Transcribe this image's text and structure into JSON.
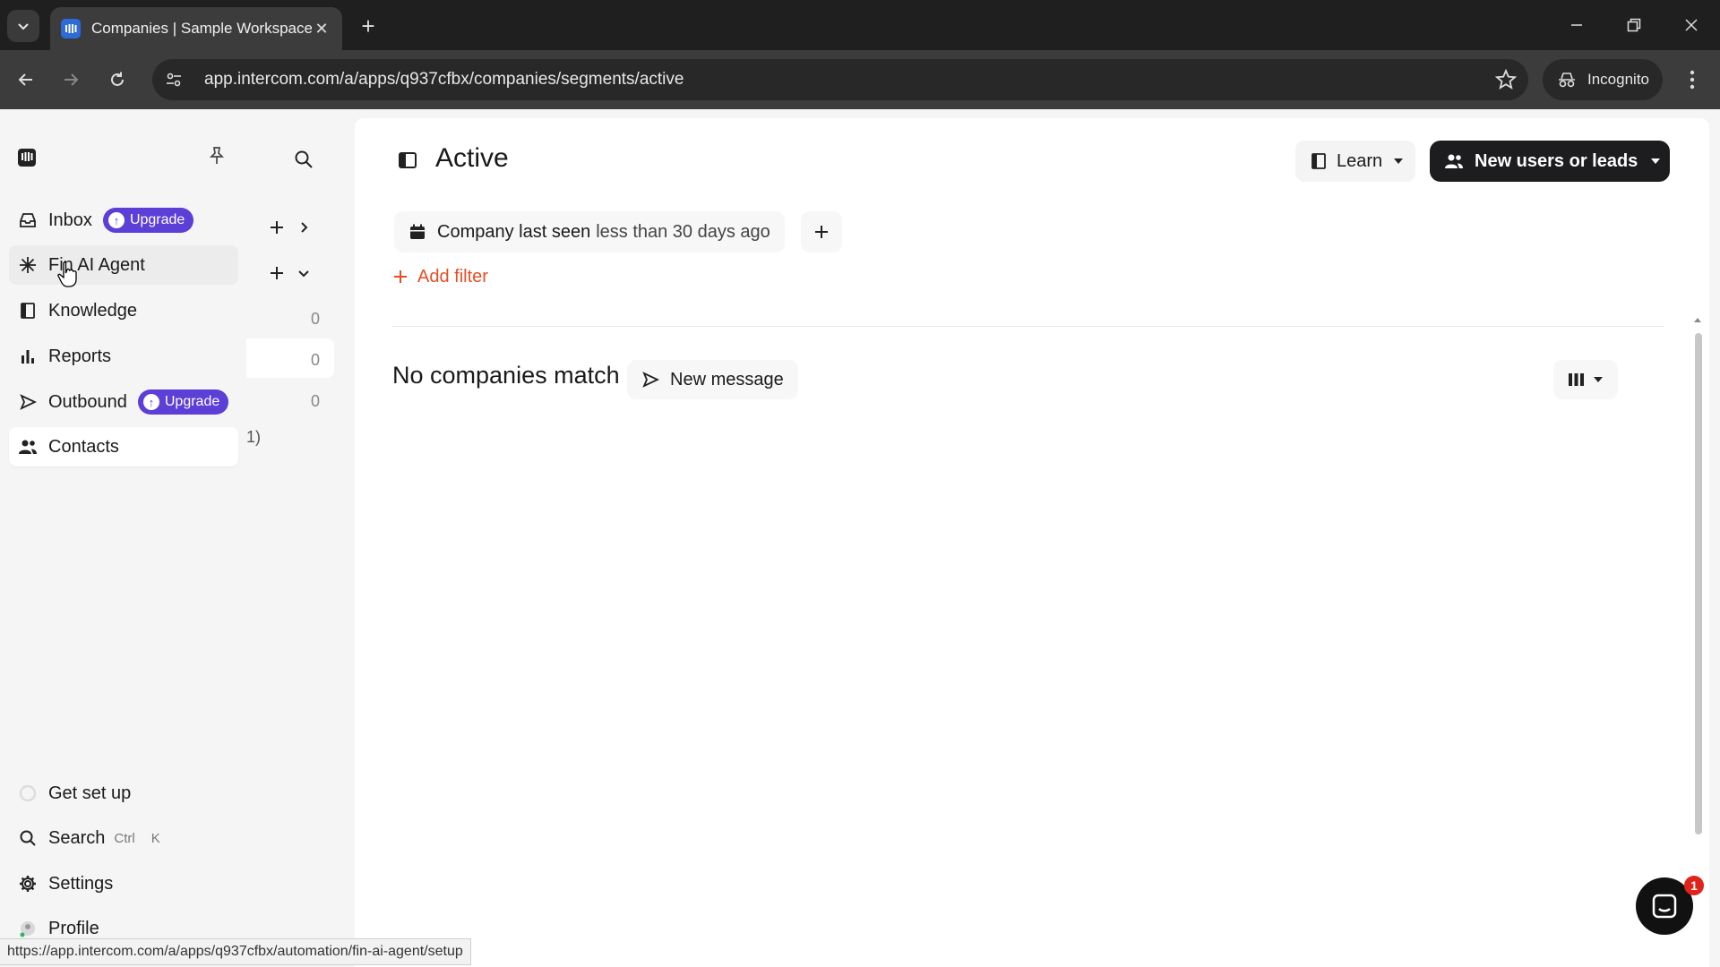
{
  "browser": {
    "tab_title": "Companies | Sample Workspace",
    "url": "app.intercom.com/a/apps/q937cfbx/companies/segments/active",
    "incognito_label": "Incognito",
    "status_url": "https://app.intercom.com/a/apps/q937cfbx/automation/fin-ai-agent/setup"
  },
  "sidebar": {
    "items": [
      {
        "label": "Inbox",
        "badge": "Upgrade"
      },
      {
        "label": "Fin AI Agent"
      },
      {
        "label": "Knowledge"
      },
      {
        "label": "Reports"
      },
      {
        "label": "Outbound",
        "badge": "Upgrade"
      },
      {
        "label": "Contacts"
      }
    ],
    "bottom": {
      "setup": "Get set up",
      "search": "Search",
      "search_kbd_1": "Ctrl",
      "search_kbd_2": "K",
      "settings": "Settings",
      "profile": "Profile"
    }
  },
  "midcol": {
    "counts": [
      "0",
      "0",
      "0"
    ],
    "fragment": "1)"
  },
  "main": {
    "title": "Active",
    "learn_label": "Learn",
    "primary_label": "New users or leads",
    "filter": {
      "field": "Company last seen",
      "condition": "less than 30 days ago"
    },
    "add_filter_label": "Add filter",
    "empty_text": "No companies match",
    "new_message_label": "New message"
  },
  "messenger": {
    "badge_count": "1"
  },
  "colors": {
    "upgrade_badge": "#5b3fd6",
    "add_filter": "#e44d26",
    "primary_button": "#1d1d1f",
    "browser_chrome": "#3c3c3c"
  }
}
